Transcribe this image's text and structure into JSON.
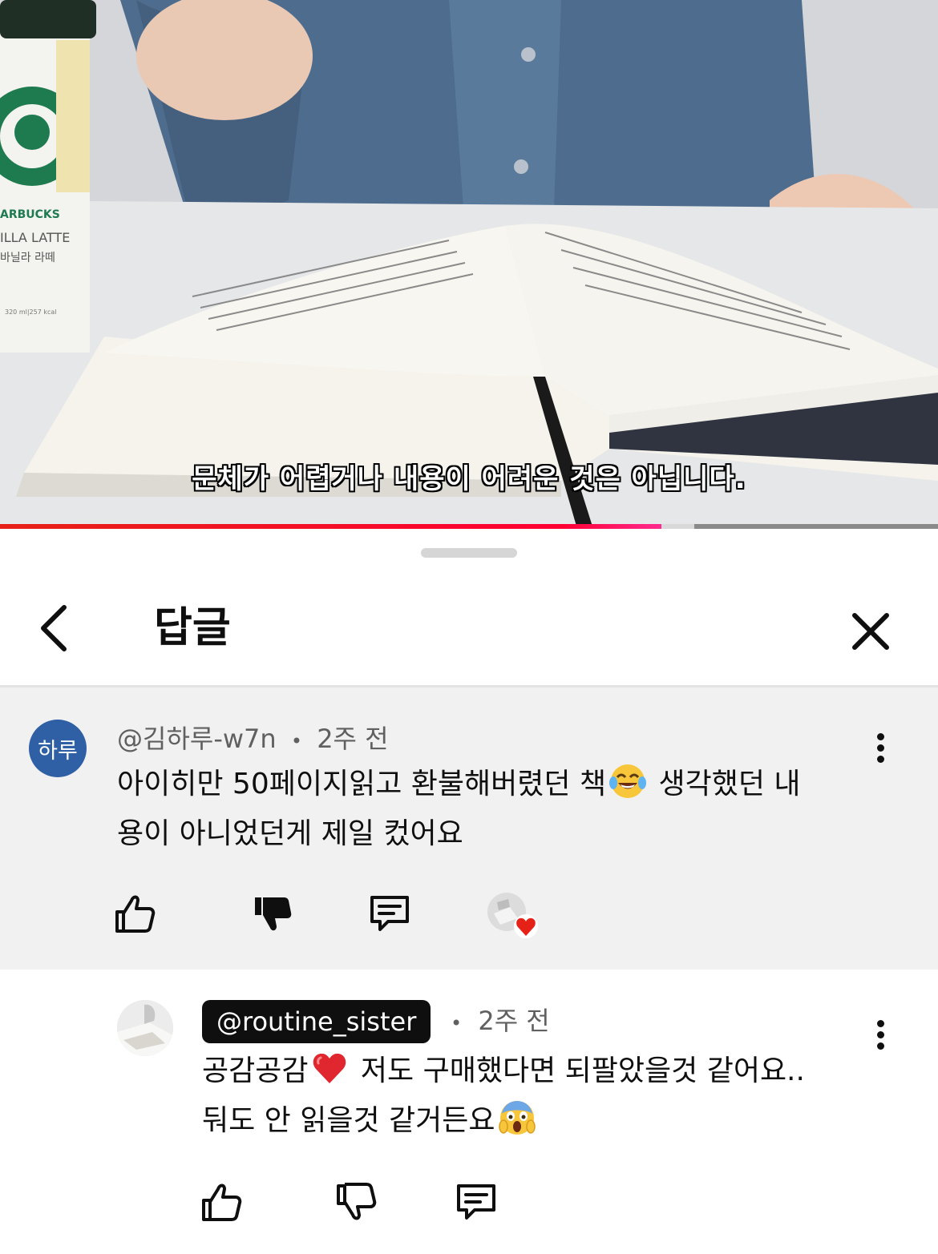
{
  "video": {
    "subtitle": "문체가 어렵거나 내용이 어려운 것은 아닙니다.",
    "cup_brand": "ARBUCKS",
    "cup_product": "ILLA LATTE",
    "cup_product_kr": "바닐라 라떼",
    "cup_info": "320 ml|257 kcal",
    "progress_played": 0.705,
    "progress_buffered": 0.74,
    "progress_color": "#ff0033"
  },
  "header": {
    "title": "답글",
    "back_icon": "chevron-left-icon",
    "close_icon": "close-icon"
  },
  "parent_comment": {
    "avatar_text": "하루",
    "avatar_color": "#2f5fa4",
    "author": "@김하루-w7n",
    "separator": "•",
    "time": "2주 전",
    "text_before_emoji": "아이히만 50페이지읽고 환불해버렸던 책",
    "emoji": "face-with-tears-of-joy",
    "text_after_emoji": " 생각했던 내",
    "text_line2": "용이 아니었던게 제일 컸어요",
    "actions": [
      "like-icon",
      "dislike-icon-filled",
      "reply-icon",
      "creator-heart-badge"
    ]
  },
  "reply_comment": {
    "author": "@routine_sister",
    "separator": "•",
    "time": "2주 전",
    "text_part1": "공감공감",
    "emoji1": "red-heart",
    "text_part2": " 저도 구매했다면 되팔았을것 같어요..",
    "text_line2": "둬도 안 읽을것 같거든요",
    "emoji2": "face-screaming-in-fear",
    "actions": [
      "like-icon",
      "dislike-icon",
      "reply-icon"
    ]
  }
}
